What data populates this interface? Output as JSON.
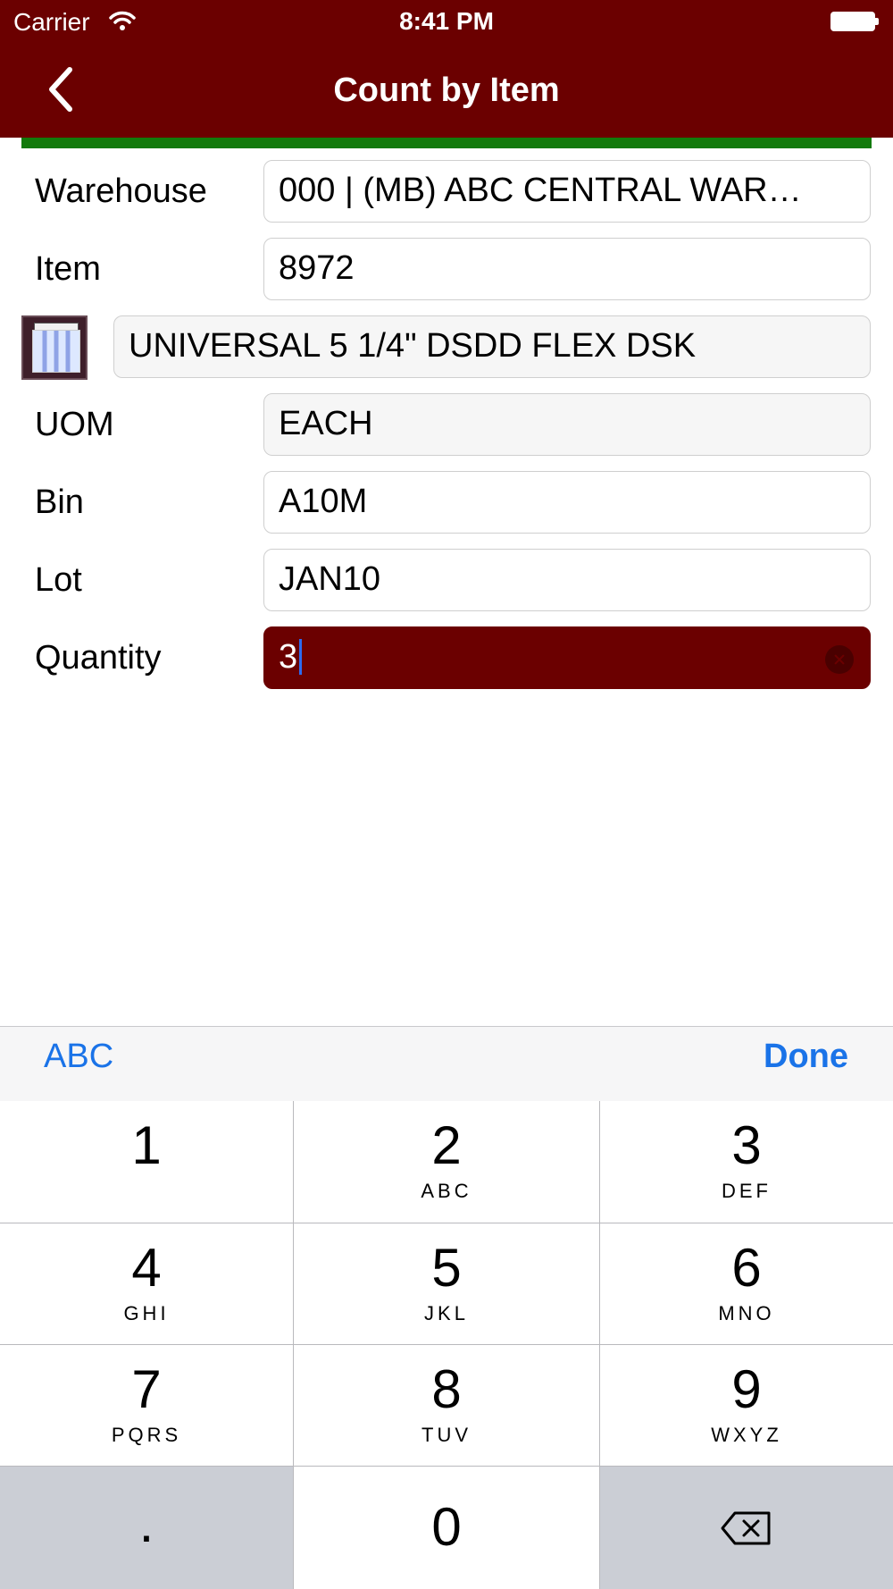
{
  "status_bar": {
    "carrier": "Carrier",
    "time": "8:41 PM"
  },
  "nav": {
    "title": "Count by Item",
    "back_icon": "chevron-left-icon"
  },
  "colors": {
    "brand": "#6b0000",
    "progress": "#127a0b",
    "link": "#1a73e8"
  },
  "form": {
    "warehouse_label": "Warehouse",
    "warehouse_value": "000 | (MB) ABC CENTRAL WAR…",
    "item_label": "Item",
    "item_value": "8972",
    "description_value": "UNIVERSAL 5 1/4\" DSDD FLEX DSK",
    "uom_label": "UOM",
    "uom_value": "EACH",
    "bin_label": "Bin",
    "bin_value": "A10M",
    "lot_label": "Lot",
    "lot_value": "JAN10",
    "quantity_label": "Quantity",
    "quantity_value": "3"
  },
  "keyboard": {
    "abc_label": "ABC",
    "done_label": "Done",
    "keys": [
      {
        "digit": "1",
        "letters": ""
      },
      {
        "digit": "2",
        "letters": "ABC"
      },
      {
        "digit": "3",
        "letters": "DEF"
      },
      {
        "digit": "4",
        "letters": "GHI"
      },
      {
        "digit": "5",
        "letters": "JKL"
      },
      {
        "digit": "6",
        "letters": "MNO"
      },
      {
        "digit": "7",
        "letters": "PQRS"
      },
      {
        "digit": "8",
        "letters": "TUV"
      },
      {
        "digit": "9",
        "letters": "WXYZ"
      }
    ],
    "dot": ".",
    "zero": "0"
  }
}
